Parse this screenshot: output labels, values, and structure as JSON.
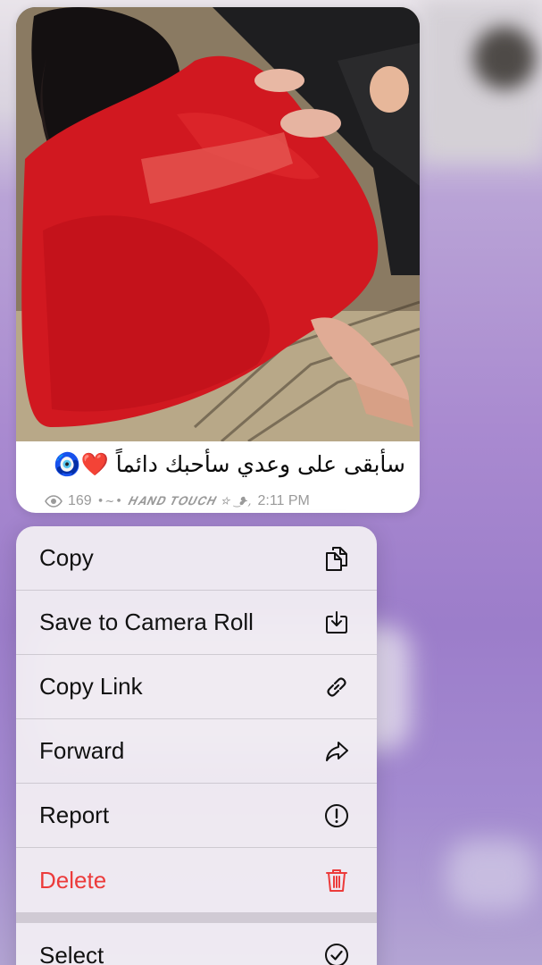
{
  "message": {
    "caption": "سأبقى على وعدي سأحبك دائماً ❤️🧿",
    "views": "169",
    "signature": "•~• 𝑯𝑨𝑵𝑫 𝑻𝑶𝑼𝑪𝑯 ☆ ͜ ❥,",
    "time": "2:11 PM"
  },
  "menu": {
    "items": [
      {
        "label": "Copy",
        "icon": "copy-icon"
      },
      {
        "label": "Save to Camera Roll",
        "icon": "save-download-icon"
      },
      {
        "label": "Copy Link",
        "icon": "link-icon"
      },
      {
        "label": "Forward",
        "icon": "forward-arrow-icon"
      },
      {
        "label": "Report",
        "icon": "exclamation-circle-icon"
      },
      {
        "label": "Delete",
        "icon": "trash-icon"
      },
      {
        "label": "Select",
        "icon": "checkmark-circle-icon"
      }
    ]
  },
  "colors": {
    "danger": "#ec3b3b",
    "menu_text": "#111111",
    "meta_text": "#9a9a9a",
    "background_purple": "#a98ad0"
  }
}
